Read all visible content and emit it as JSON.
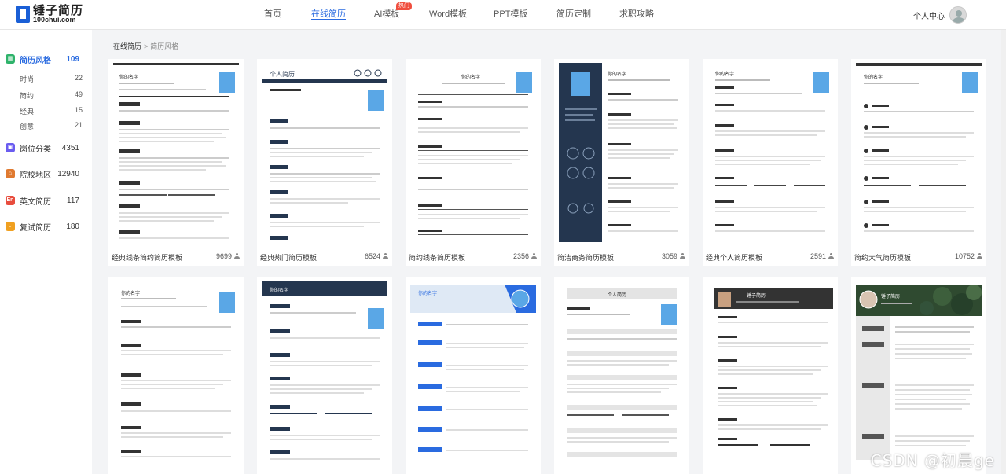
{
  "logo": {
    "cn": "锤子简历",
    "en": "100chui.com"
  },
  "nav": [
    {
      "label": "首页"
    },
    {
      "label": "在线简历"
    },
    {
      "label": "AI模板",
      "badge": "热门"
    },
    {
      "label": "Word模板"
    },
    {
      "label": "PPT模板"
    },
    {
      "label": "简历定制"
    },
    {
      "label": "求职攻略"
    }
  ],
  "user": {
    "label": "个人中心"
  },
  "sidebar": {
    "categories": [
      {
        "label": "简历风格",
        "count": "109",
        "icon": "grid-icon",
        "color": "#2fb36b"
      },
      {
        "label": "岗位分类",
        "count": "4351",
        "icon": "briefcase-icon",
        "color": "#6a5cf0"
      },
      {
        "label": "院校地区",
        "count": "12940",
        "icon": "school-icon",
        "color": "#e07a30"
      },
      {
        "label": "英文简历",
        "count": "117",
        "icon": "en-icon",
        "color": "#e84c3d"
      },
      {
        "label": "复试简历",
        "count": "180",
        "icon": "cloche-icon",
        "color": "#f0a020"
      }
    ],
    "subs": [
      {
        "label": "时尚",
        "count": "22"
      },
      {
        "label": "简约",
        "count": "49"
      },
      {
        "label": "经典",
        "count": "15"
      },
      {
        "label": "创意",
        "count": "21"
      }
    ]
  },
  "breadcrumb": {
    "root": "在线简历",
    "sep": ">",
    "current": "简历风格"
  },
  "cards": [
    {
      "title": "经典线条简约简历模板",
      "count": "9699",
      "name": "你的名字"
    },
    {
      "title": "经典热门简历模板",
      "count": "6524",
      "name": "个人简历"
    },
    {
      "title": "简约线条简历模板",
      "count": "2356",
      "name": "你的名字"
    },
    {
      "title": "简洁商务简历模板",
      "count": "3059",
      "name": "你的名字"
    },
    {
      "title": "经典个人简历模板",
      "count": "2591",
      "name": "你的名字"
    },
    {
      "title": "简约大气简历模板",
      "count": "10752",
      "name": "你的名字"
    },
    {
      "title": "",
      "count": "",
      "name": "你的名字"
    },
    {
      "title": "",
      "count": "",
      "name": "你的名字"
    },
    {
      "title": "",
      "count": "",
      "name": "你的名字"
    },
    {
      "title": "",
      "count": "",
      "name": "个人简历"
    },
    {
      "title": "",
      "count": "",
      "name": "锤子简历"
    },
    {
      "title": "",
      "count": "",
      "name": "锤子简历"
    }
  ],
  "watermark": "CSDN @初晨ge",
  "colors": {
    "accent": "#2a6be0",
    "navy": "#24364f"
  }
}
